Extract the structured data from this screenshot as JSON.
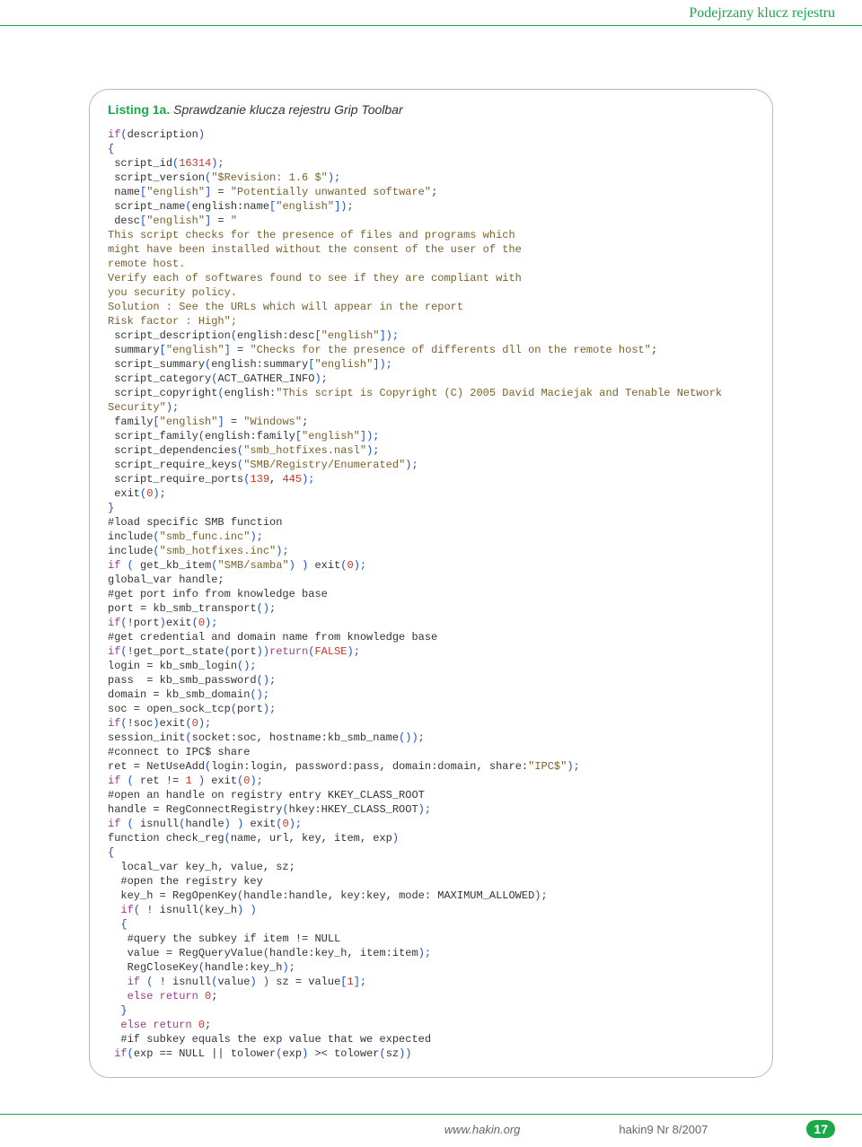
{
  "header": {
    "title": "Podejrzany klucz rejestru"
  },
  "listing": {
    "label": "Listing 1a.",
    "caption": "Sprawdzanie klucza rejestru Grip Toolbar"
  },
  "code": {
    "l1_kw": "if",
    "l1_rest": "description",
    "l3": "script_id",
    "l3_num": "16314",
    "l4a": "script_version",
    "l4_str": "\"$Revision: 1.6 $\"",
    "l5a": "name",
    "l5_idx": "\"english\"",
    "l5_str": "\"Potentially unwanted software\"",
    "l6a": "script_name",
    "l6b": "english:name",
    "l6_idx": "\"english\"",
    "l7a": "desc",
    "l7_idx": "\"english\"",
    "l7_str_open": "\"",
    "t1": "This script checks for the presence of files and programs which",
    "t2": "might have been installed without the consent of the user of the",
    "t3": "remote host.",
    "t4": "Verify each of softwares found to see if they are compliant with",
    "t5": "you security policy.",
    "t6": "Solution : See the URLs which will appear in the report",
    "t7": "Risk factor : High\";",
    "l8a": "script_description",
    "l8b": "english:desc",
    "l8_idx": "\"english\"",
    "l9a": "summary",
    "l9_idx": "\"english\"",
    "l9_str": "\"Checks for the presence of differents dll on the remote host\"",
    "l10a": "script_summary",
    "l10b": "english:summary",
    "l10_idx": "\"english\"",
    "l11a": "script_category",
    "l11b": "ACT_GATHER_INFO",
    "l12a": "script_copyright",
    "l12b": "english:",
    "l12_str": "\"This script is Copyright (C) 2005 David Maciejak and Tenable Network Security\"",
    "l13a": "family",
    "l13_idx": "\"english\"",
    "l13_str": "\"Windows\"",
    "l14a": "script_family",
    "l14b": "english:family",
    "l14_idx": "\"english\"",
    "l15a": "script_dependencies",
    "l15_str": "\"smb_hotfixes.nasl\"",
    "l16a": "script_require_keys",
    "l16_str": "\"SMB/Registry/Enumerated\"",
    "l17a": "script_require_ports",
    "l17_n1": "139",
    "l17_n2": "445",
    "l18a": "exit",
    "l18_n": "0",
    "c1": "#load specific SMB function",
    "l19a": "include",
    "l19_str": "\"smb_func.inc\"",
    "l20a": "include",
    "l20_str": "\"smb_hotfixes.inc\"",
    "l21_kw": "if",
    "l21_fn": "get_kb_item",
    "l21_str": "\"SMB/samba\"",
    "l21_fn2": "exit",
    "l21_n": "0",
    "l22": "global_var handle;",
    "c2": "#get port info from knowledge base",
    "l23a": "port",
    "l23b": "kb_smb_transport",
    "l24_kw": "if",
    "l24a": "!port",
    "l24b": "exit",
    "l24_n": "0",
    "c3": "#get credential and domain name from knowledge base",
    "l25_kw": "if",
    "l25a": "!get_port_state",
    "l25arg": "port",
    "l25_ret": "return",
    "l25_false": "FALSE",
    "l26": "login = kb_smb_login",
    "l27": "pass  = kb_smb_password",
    "l28": "domain = kb_smb_domain",
    "l29a": "soc = open_sock_tcp",
    "l29b": "port",
    "l30_kw": "if",
    "l30a": "!soc",
    "l30b": "exit",
    "l30_n": "0",
    "l31a": "session_init",
    "l31b": "socket:soc, hostname:kb_smb_name",
    "c4": "#connect to IPC$ share",
    "l32a": "ret = NetUseAdd",
    "l32b": "login:login, password:pass, domain:domain, share:",
    "l32_str": "\"IPC$\"",
    "l33_kw": "if",
    "l33a": "ret !=",
    "l33_n1": "1",
    "l33b": "exit",
    "l33_n2": "0",
    "c5": "#open an handle on registry entry KKEY_CLASS_ROOT",
    "l34a": "handle = RegConnectRegistry",
    "l34b": "hkey:HKEY_CLASS_ROOT",
    "l35_kw": "if",
    "l35a": "isnull",
    "l35b": "handle",
    "l35c": "exit",
    "l35_n": "0",
    "l36a": "function check_reg",
    "l36b": "name, url, key, item, exp",
    "l37": "local_var key_h, value, sz;",
    "c6": "#open the registry key",
    "l38a": "key_h = RegOpenKey",
    "l38b": "handle:handle, key:key, mode: MAXIMUM_ALLOWED",
    "l39_kw": "if",
    "l39a": "! isnull",
    "l39b": "key_h",
    "c7": "#query the subkey if item != NULL",
    "l40a": "value = RegQueryValue",
    "l40b": "handle:key_h, item:item",
    "l41a": "RegCloseKey",
    "l41b": "handle:key_h",
    "l42_kw": "if",
    "l42a": "! isnull",
    "l42b": "value",
    "l42c": "sz = value",
    "l42_n": "1",
    "l43_else": "else",
    "l43_ret": "return",
    "l43_n": "0",
    "l44_else": "else",
    "l44_ret": "return",
    "l44_n": "0",
    "c8": "#if subkey equals the exp value that we expected",
    "l45_kw": "if",
    "l45a": "exp == NULL || tolower",
    "l45b": "exp",
    "l45c": ">< tolower",
    "l45d": "sz"
  },
  "footer": {
    "url": "www.hakin.org",
    "issue": "hakin9 Nr 8/2007",
    "page": "17"
  }
}
